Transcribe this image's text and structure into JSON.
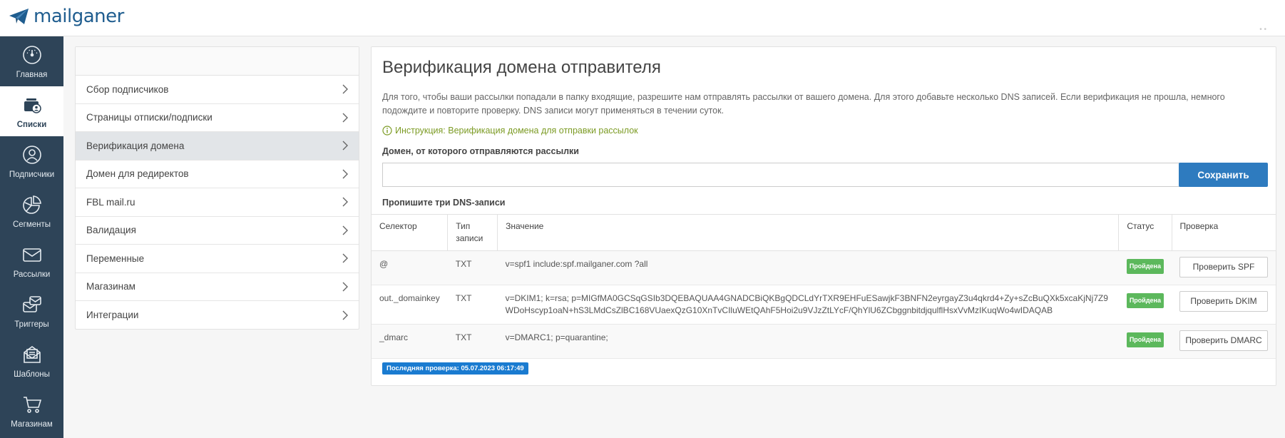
{
  "app": {
    "logo_text": "mailganer"
  },
  "sidebar": {
    "items": [
      {
        "label": "Главная",
        "icon": "dashboard-gauge-icon",
        "active": false
      },
      {
        "label": "Списки",
        "icon": "lists-contacts-icon",
        "active": true
      },
      {
        "label": "Подписчики",
        "icon": "user-circle-icon",
        "active": false
      },
      {
        "label": "Сегменты",
        "icon": "pie-chart-icon",
        "active": false
      },
      {
        "label": "Рассылки",
        "icon": "envelope-icon",
        "active": false
      },
      {
        "label": "Триггеры",
        "icon": "triggers-icon",
        "active": false
      },
      {
        "label": "Шаблоны",
        "icon": "template-icon",
        "active": false
      },
      {
        "label": "Магазинам",
        "icon": "shopping-cart-icon",
        "active": false
      }
    ]
  },
  "settings_menu": {
    "items": [
      {
        "label": "Сбор подписчиков",
        "active": false
      },
      {
        "label": "Страницы отписки/подписки",
        "active": false
      },
      {
        "label": "Верификация домена",
        "active": true
      },
      {
        "label": "Домен для редиректов",
        "active": false
      },
      {
        "label": "FBL mail.ru",
        "active": false
      },
      {
        "label": "Валидация",
        "active": false
      },
      {
        "label": "Переменные",
        "active": false
      },
      {
        "label": "Магазинам",
        "active": false
      },
      {
        "label": "Интеграции",
        "active": false
      }
    ]
  },
  "main": {
    "title": "Верификация домена отправителя",
    "description": "Для того, чтобы ваши рассылки попадали в папку входящие, разрешите нам отправлять рассылки от вашего домена. Для этого добавьте несколько DNS записей. Если верификация не прошла, немного подождите и повторите проверку. DNS записи могут применяться в течении суток.",
    "instruction_link": "Инструкция: Верификация домена для отправки рассылок",
    "domain_label": "Домен, от которого отправляются рассылки",
    "domain_value": "",
    "save_label": "Сохранить",
    "dns_label": "Пропишите три DNS-записи",
    "table": {
      "headers": [
        "Селектор",
        "Тип записи",
        "Значение",
        "Статус",
        "Проверка"
      ],
      "rows": [
        {
          "selector": "@",
          "type": "TXT",
          "value": "v=spf1 include:spf.mailganer.com ?all",
          "status": "Пройдена",
          "button": "Проверить SPF"
        },
        {
          "selector": "out._domainkey",
          "type": "TXT",
          "value": "v=DKIM1; k=rsa; p=MIGfMA0GCSqGSIb3DQEBAQUAA4GNADCBiQKBgQDCLdYrTXR9EHFuESawjkF3BNFN2eyrgayZ3u4qkrd4+Zy+sZcBuQXk5xcaKjNj7Z9WDoHscyp1oaN+hS3LMdCsZlBC168VUaexQzG10XnTvCIluWEtQAhF5Hoi2u9VJzZtLYcF/QhYlU6ZCbggnbitdjqulflHsxVvMzIKuqWo4wIDAQAB",
          "status": "Пройдена",
          "button": "Проверить DKIM"
        },
        {
          "selector": "_dmarc",
          "type": "TXT",
          "value": "v=DMARC1; p=quarantine;",
          "status": "Пройдена",
          "button": "Проверить DMARC"
        }
      ]
    },
    "last_check": "Последняя проверка: 05.07.2023 06:17:49"
  },
  "colors": {
    "sidebar_bg": "#2e4458",
    "primary_button": "#2e7bbf",
    "status_passed": "#5cb85c",
    "instruction_link": "#7c9b24",
    "last_check_badge": "#1a7bd0"
  }
}
